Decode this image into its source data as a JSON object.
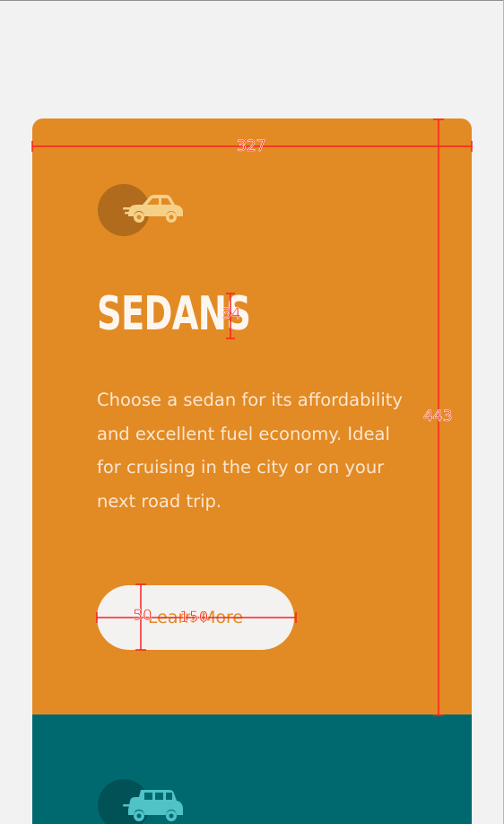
{
  "cards": [
    {
      "title": "SEDANS",
      "description": "Choose a sedan for its affordability and excellent fuel economy. Ideal for cruising in the city or on your next road trip.",
      "button_label": "Learn More",
      "icon": "sedan-car-icon",
      "background_color": "#e28a24"
    },
    {
      "icon": "suv-car-icon",
      "background_color": "#006970"
    }
  ],
  "measurements": {
    "card_width": "327",
    "card_height": "443",
    "title_height": "34",
    "button_height": "50",
    "button_width": "150"
  },
  "colors": {
    "page_background": "#f2f2f2",
    "orange": "#e28a24",
    "teal": "#006970",
    "button_background": "#f3f2f0",
    "measurement": "#ff2020"
  }
}
